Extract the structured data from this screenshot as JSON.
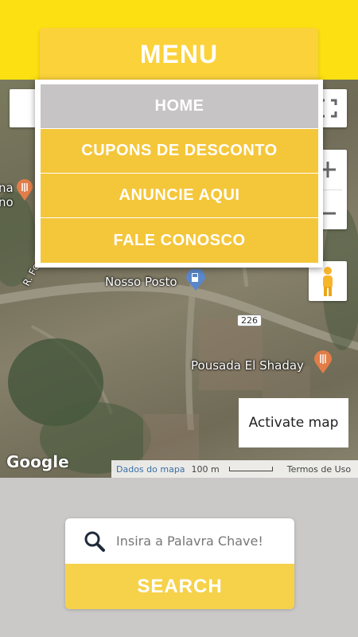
{
  "menu": {
    "title": "MENU",
    "items": [
      {
        "label": "HOME",
        "active": true
      },
      {
        "label": "CUPONS DE DESCONTO",
        "active": false
      },
      {
        "label": "ANUNCIE AQUI",
        "active": false
      },
      {
        "label": "FALE CONOSCO",
        "active": false
      }
    ]
  },
  "map": {
    "places": {
      "nosso_posto": "Nosso Posto",
      "pousada": "Pousada El Shaday",
      "street_partial": "R. Fco Al",
      "left_place_partial_1": "na",
      "left_place_partial_2": "no"
    },
    "road_number": "226",
    "activate_label": "Activate map",
    "google_logo": "Google",
    "attribution": {
      "data_link": "Dados do mapa",
      "scale": "100 m",
      "terms": "Termos de Uso"
    },
    "icons": [
      "fullscreen-icon",
      "zoom-in-icon",
      "zoom-out-icon",
      "pegman-icon",
      "gas-station-icon",
      "restaurant-pin-icon"
    ]
  },
  "search": {
    "placeholder": "Insira a Palavra Chave!",
    "value": "",
    "button_label": "SEARCH"
  },
  "colors": {
    "topbar": "#fce012",
    "menu_accent": "#f4c63a",
    "menu_active": "#c6c4c4",
    "background": "#cbc8c8"
  }
}
